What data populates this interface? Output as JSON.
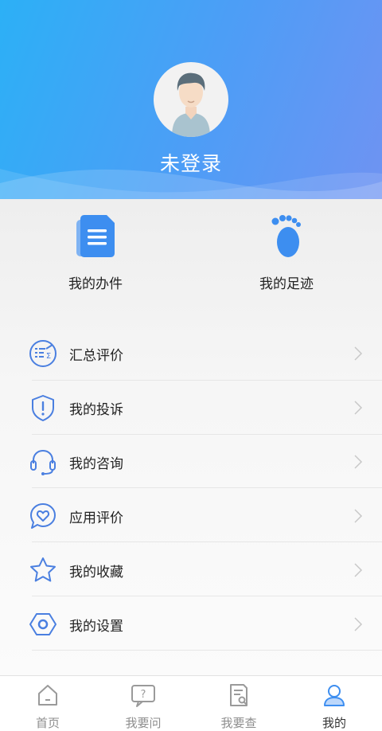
{
  "profile": {
    "username": "未登录"
  },
  "quick_actions": [
    {
      "label": "我的办件",
      "icon": "documents-icon"
    },
    {
      "label": "我的足迹",
      "icon": "footprint-icon"
    }
  ],
  "menu": [
    {
      "label": "汇总评价",
      "icon": "summary-list-icon"
    },
    {
      "label": "我的投诉",
      "icon": "shield-alert-icon"
    },
    {
      "label": "我的咨询",
      "icon": "headset-icon"
    },
    {
      "label": "应用评价",
      "icon": "heart-bubble-icon"
    },
    {
      "label": "我的收藏",
      "icon": "star-icon"
    },
    {
      "label": "我的设置",
      "icon": "settings-hexagon-icon"
    }
  ],
  "tabbar": [
    {
      "label": "首页",
      "icon": "home-icon"
    },
    {
      "label": "我要问",
      "icon": "question-bubble-icon"
    },
    {
      "label": "我要查",
      "icon": "search-document-icon"
    },
    {
      "label": "我的",
      "icon": "user-icon",
      "active": true
    }
  ],
  "colors": {
    "accent": "#4a7fe0",
    "header_start": "#2cb0f6",
    "header_end": "#6f93f2",
    "icon_blue": "#3d8ef0"
  }
}
